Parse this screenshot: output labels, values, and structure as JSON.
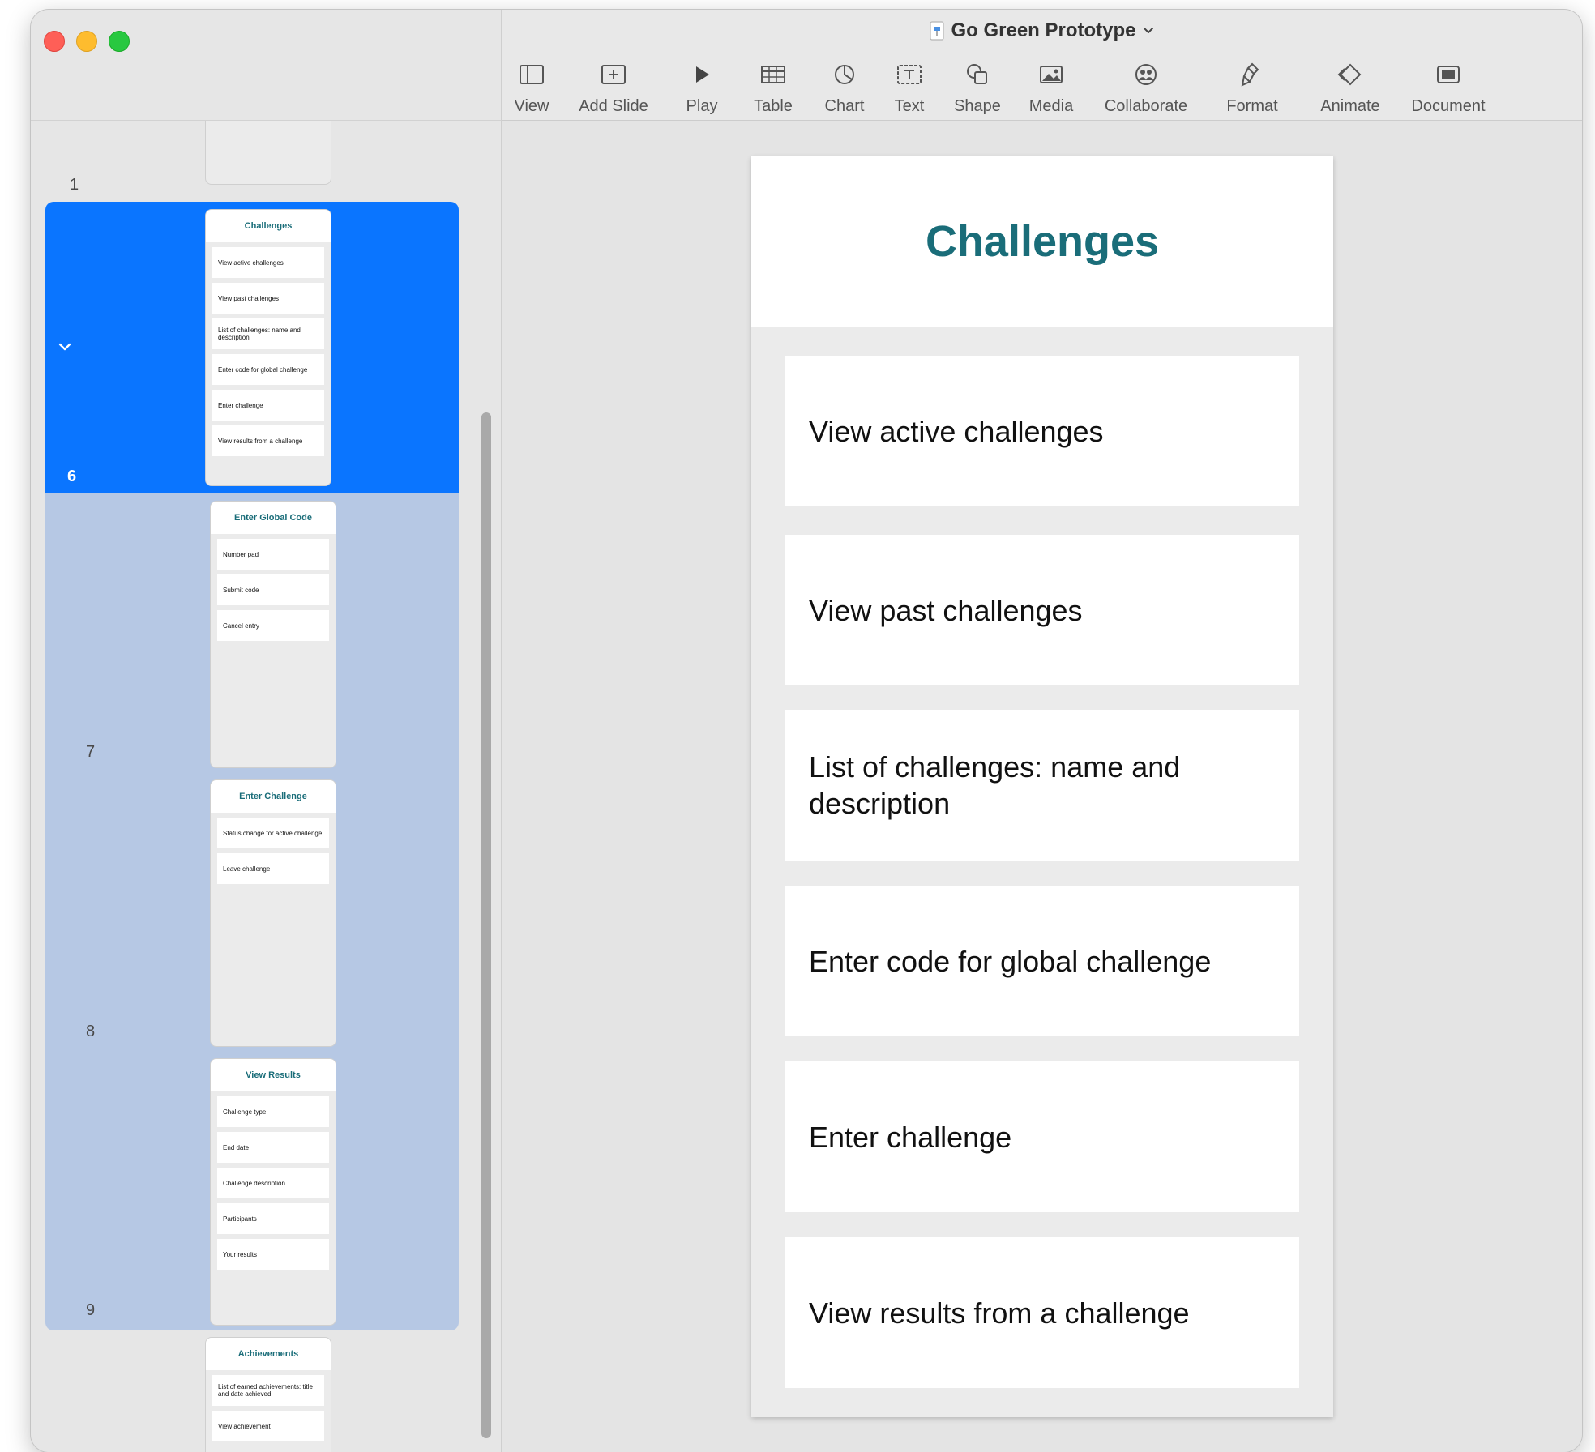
{
  "window": {
    "title": "Go Green Prototype"
  },
  "toolbar": {
    "items": [
      {
        "label": "View",
        "icon": "sidebar-view-icon"
      },
      {
        "label": "Add Slide",
        "icon": "add-slide-icon"
      },
      {
        "label": "Play",
        "icon": "play-icon"
      },
      {
        "label": "Table",
        "icon": "table-icon"
      },
      {
        "label": "Chart",
        "icon": "chart-icon"
      },
      {
        "label": "Text",
        "icon": "text-box-icon"
      },
      {
        "label": "Shape",
        "icon": "shape-icon"
      },
      {
        "label": "Media",
        "icon": "media-icon"
      },
      {
        "label": "Collaborate",
        "icon": "collaborate-icon"
      },
      {
        "label": "Format",
        "icon": "format-brush-icon"
      },
      {
        "label": "Animate",
        "icon": "animate-icon"
      },
      {
        "label": "Document",
        "icon": "document-icon"
      }
    ],
    "overflow_icon": "chevron-double-right-icon"
  },
  "navigator": {
    "slides": [
      {
        "number": "1",
        "title": "",
        "items": []
      },
      {
        "number": "6",
        "title": "Challenges",
        "items": [
          "View active challenges",
          "View past challenges",
          "List of challenges: name and description",
          "Enter code for global challenge",
          "Enter challenge",
          "View results from a challenge"
        ]
      },
      {
        "number": "7",
        "title": "Enter Global Code",
        "items": [
          "Number pad",
          "Submit code",
          "Cancel entry"
        ]
      },
      {
        "number": "8",
        "title": "Enter Challenge",
        "items": [
          "Status change for active challenge",
          "Leave challenge"
        ]
      },
      {
        "number": "9",
        "title": "View Results",
        "items": [
          "Challenge type",
          "End date",
          "Challenge description",
          "Participants",
          "Your results"
        ]
      },
      {
        "number": "",
        "title": "Achievements",
        "items": [
          "List of earned achievements: title and date achieved",
          "View achievement"
        ]
      }
    ]
  },
  "slide": {
    "title": "Challenges",
    "items": [
      "View active challenges",
      "View past challenges",
      "List of challenges: name and description",
      "Enter code for global challenge",
      "Enter challenge",
      "View results from a challenge"
    ]
  },
  "colors": {
    "selection_primary": "#0a75ff",
    "selection_secondary": "#b6c8e4",
    "title_teal": "#1a6d79"
  }
}
